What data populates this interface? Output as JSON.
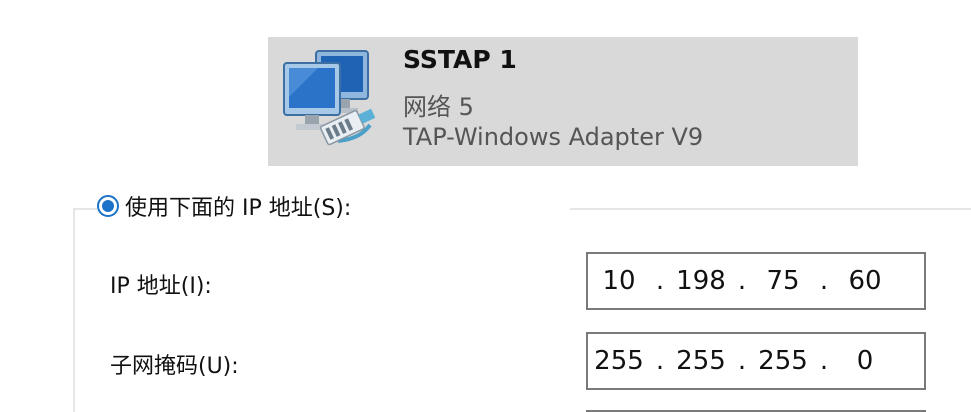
{
  "adapter": {
    "name": "SSTAP 1",
    "network": "网络 5",
    "device": "TAP-Windows Adapter V9",
    "icon": "network-adapter-icon"
  },
  "ip_settings": {
    "use_following_label": "使用下面的 IP 地址(S):",
    "use_following_selected": true,
    "ip_address": {
      "label": "IP 地址(I):",
      "octets": [
        "10",
        "198",
        "75",
        "60"
      ]
    },
    "subnet_mask": {
      "label": "子网掩码(U):",
      "octets": [
        "255",
        "255",
        "255",
        "0"
      ]
    }
  },
  "colors": {
    "accent": "#1a73c9",
    "card_bg": "#d9d9d9",
    "secondary_text": "#555555"
  }
}
